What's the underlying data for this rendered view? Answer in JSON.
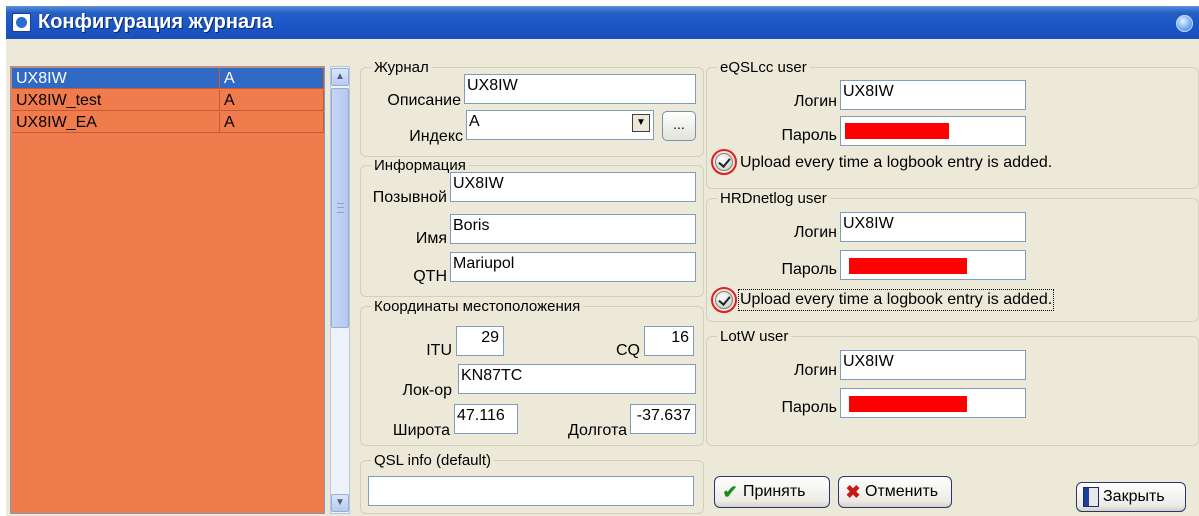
{
  "window": {
    "title": "Конфигурация журнала"
  },
  "logbooks": [
    {
      "name": "UX8IW",
      "index": "A"
    },
    {
      "name": "UX8IW_test",
      "index": "A"
    },
    {
      "name": "UX8IW_EA",
      "index": "A"
    }
  ],
  "journal": {
    "legend": "Журнал",
    "description_label": "Описание",
    "description_value": "UX8IW",
    "index_label": "Индекс",
    "index_value": "A",
    "browse_label": "..."
  },
  "info": {
    "legend": "Информация",
    "callsign_label": "Позывной",
    "callsign_value": "UX8IW",
    "name_label": "Имя",
    "name_value": "Boris",
    "qth_label": "QTH",
    "qth_value": "Mariupol"
  },
  "coords": {
    "legend": "Координаты местоположения",
    "itu_label": "ITU",
    "itu_value": "29",
    "cq_label": "CQ",
    "cq_value": "16",
    "locator_label": "Лок-ор",
    "locator_value": "KN87TC",
    "lat_label": "Широта",
    "lat_value": "47.116",
    "lon_label": "Долгота",
    "lon_value": "-37.637"
  },
  "qsl": {
    "legend": "QSL info (default)",
    "value": ""
  },
  "eqsl": {
    "legend": "eQSLcc user",
    "login_label": "Логин",
    "login_value": "UX8IW",
    "password_label": "Пароль",
    "upload_label": "Upload every time a logbook entry is added.",
    "upload_checked": true
  },
  "hrd": {
    "legend": "HRDnetlog user",
    "login_label": "Логин",
    "login_value": "UX8IW",
    "password_label": "Пароль",
    "upload_label": "Upload every time a logbook entry is added.",
    "upload_checked": true
  },
  "lotw": {
    "legend": "LotW user",
    "login_label": "Логин",
    "login_value": "UX8IW",
    "password_label": "Пароль"
  },
  "buttons": {
    "accept": "Принять",
    "cancel": "Отменить",
    "close": "Закрыть"
  },
  "colors": {
    "list_bg": "#f07c4e",
    "selection": "#316ac5",
    "password_mask": "#ff0000",
    "highlight_ring": "#e02020"
  }
}
